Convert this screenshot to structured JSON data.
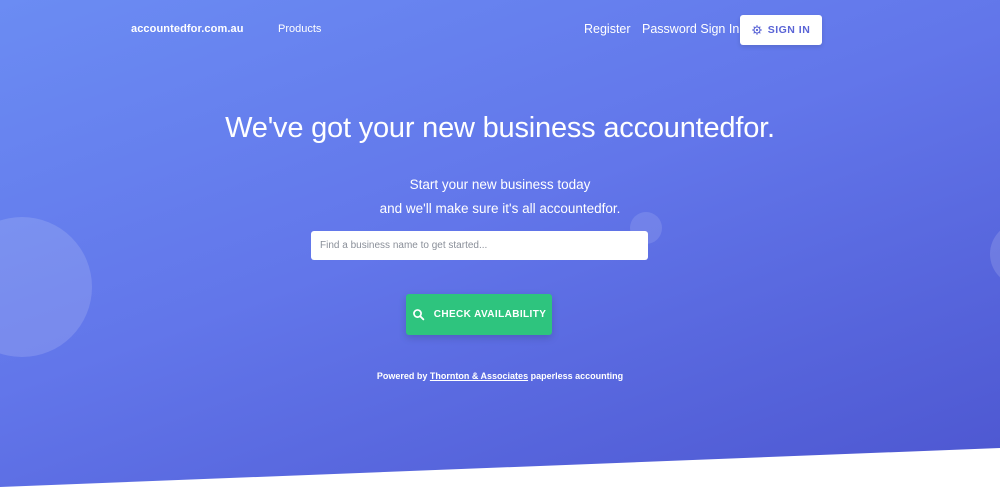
{
  "nav": {
    "brand": "accountedfor.com.au",
    "products": "Products",
    "register": "Register",
    "password_sign_in": "Password Sign In",
    "sign_in": "SIGN IN",
    "sign_in_icon": "gear-icon"
  },
  "hero": {
    "title": "We've got your new business accountedfor.",
    "subtitle_line1": "Start your new business today",
    "subtitle_line2": "and we'll make sure it's all accountedfor."
  },
  "search": {
    "placeholder": "Find a business name to get started...",
    "value": "",
    "button_label": "CHECK AVAILABILITY",
    "button_icon": "search-icon"
  },
  "footer": {
    "powered_prefix": "Powered by ",
    "powered_link": "Thornton & Associates",
    "powered_suffix": " paperless accounting"
  },
  "colors": {
    "gradient_start": "#6b8cf3",
    "gradient_end": "#4c55cf",
    "accent_green": "#2ec47e",
    "sign_in_text": "#5a64d6"
  }
}
